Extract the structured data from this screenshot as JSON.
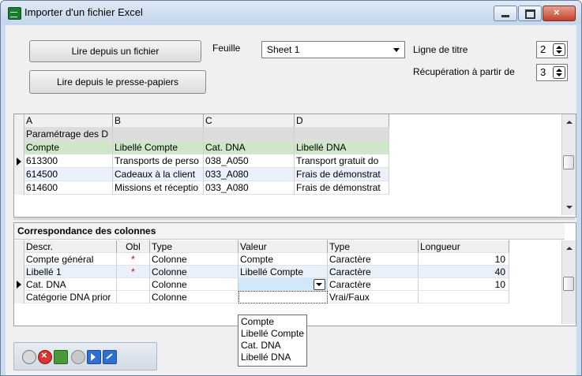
{
  "window": {
    "title": "Importer d'un fichier Excel",
    "icon": "excel-icon"
  },
  "top": {
    "btn_file": "Lire depuis un fichier",
    "btn_clipboard": "Lire depuis le presse-papiers",
    "sheet_label": "Feuille",
    "sheet_value": "Sheet 1",
    "title_row_label": "Ligne de titre",
    "title_row_value": "2",
    "start_row_label": "Récupération à partir de",
    "start_row_value": "3"
  },
  "sheet_grid": {
    "headers": [
      "A",
      "B",
      "C",
      "D"
    ],
    "rows": [
      {
        "style": "gray",
        "cells": [
          "Paramétrage des D",
          "",
          "",
          ""
        ]
      },
      {
        "style": "green",
        "cells": [
          "Compte",
          "Libellé Compte",
          "Cat. DNA",
          "Libellé DNA"
        ]
      },
      {
        "style": "current",
        "cells": [
          "613300",
          "Transports de perso",
          "038_A050",
          "Transport gratuit do"
        ]
      },
      {
        "style": "alt",
        "cells": [
          "614500",
          "Cadeaux à la client",
          "033_A080",
          "Frais de démonstrat"
        ]
      },
      {
        "style": "plain",
        "cells": [
          "614600",
          "Missions et réceptio",
          "033_A080",
          "Frais de démonstrat"
        ]
      }
    ]
  },
  "mapping": {
    "title": "Correspondance des colonnes",
    "headers": [
      "Descr.",
      "Obl",
      "Type",
      "Valeur",
      "Type",
      "Longueur"
    ],
    "rows": [
      {
        "cells": [
          "Compte général",
          "*",
          "Colonne",
          "Compte",
          "Caractère",
          "10"
        ]
      },
      {
        "cells": [
          "Libellé 1",
          "*",
          "Colonne",
          "Libellé Compte",
          "Caractère",
          "40"
        ]
      },
      {
        "cells": [
          "Cat. DNA",
          "",
          "Colonne",
          "",
          "Caractère",
          "10"
        ]
      },
      {
        "cells": [
          "Catégorie DNA prior",
          "",
          "Colonne",
          "",
          "Vrai/Faux",
          ""
        ]
      }
    ],
    "dropdown_options": [
      "Compte",
      "Libellé Compte",
      "Cat. DNA",
      "Libellé DNA"
    ]
  },
  "toolbar": {
    "icons": [
      "link-icon",
      "cancel-icon",
      "import-icon",
      "settings-icon",
      "next-icon",
      "export-icon"
    ]
  }
}
